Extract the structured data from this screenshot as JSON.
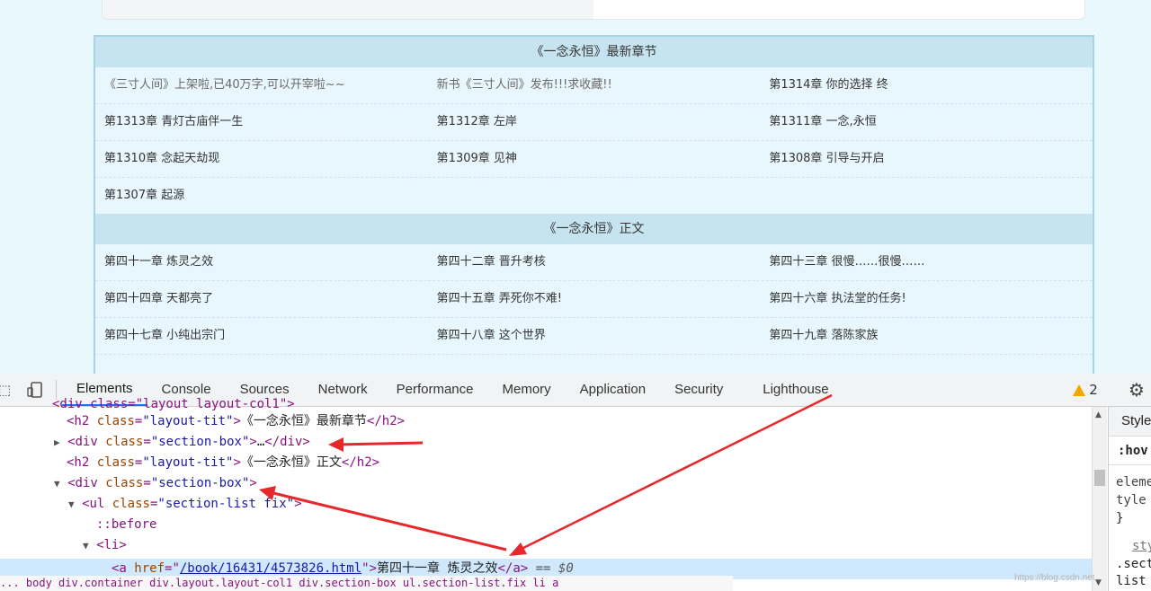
{
  "page": {
    "sections": [
      {
        "title": "《一念永恒》最新章节",
        "rows": [
          [
            "《三寸人间》上架啦,已40万字,可以开宰啦~~",
            "新书《三寸人间》发布!!!求收藏!!",
            "第1314章 你的选择 终"
          ],
          [
            "第1313章 青灯古庙伴一生",
            "第1312章 左岸",
            "第1311章 一念,永恒"
          ],
          [
            "第1310章 念起天劫现",
            "第1309章 见神",
            "第1308章 引导与开启"
          ],
          [
            "第1307章 起源",
            "",
            ""
          ]
        ]
      },
      {
        "title": "《一念永恒》正文",
        "rows": [
          [
            "第四十一章 炼灵之效",
            "第四十二章 晋升考核",
            "第四十三章 很慢……很慢……"
          ],
          [
            "第四十四章 天都亮了",
            "第四十五章 弄死你不难!",
            "第四十六章 执法堂的任务!"
          ],
          [
            "第四十七章 小纯出宗门",
            "第四十八章 这个世界",
            "第四十九章 落陈家族"
          ],
          [
            "",
            "",
            ""
          ]
        ]
      }
    ]
  },
  "devtools": {
    "tabs": [
      "Elements",
      "Console",
      "Sources",
      "Network",
      "Performance",
      "Memory",
      "Application",
      "Security",
      "Lighthouse"
    ],
    "active_tab": "Elements",
    "warning_count": "2",
    "dom": {
      "l0": {
        "tag_open": "<div class=\"layout layout-col1\">"
      },
      "l1": {
        "open": "<h2",
        "attr": "class",
        "val": "\"layout-tit\"",
        "close": ">",
        "text": "《一念永恒》最新章节",
        "end": "</h2>"
      },
      "l2": {
        "open": "<div",
        "attr": "class",
        "val": "\"section-box\"",
        "close": ">",
        "text": "…",
        "end": "</div>"
      },
      "l3": {
        "open": "<h2",
        "attr": "class",
        "val": "\"layout-tit\"",
        "close": ">",
        "text": "《一念永恒》正文",
        "end": "</h2>"
      },
      "l4": {
        "open": "<div",
        "attr": "class",
        "val": "\"section-box\"",
        "close": ">"
      },
      "l5": {
        "open": "<ul",
        "attr": "class",
        "val": "\"section-list fix\"",
        "close": ">"
      },
      "l6": {
        "text": "::before"
      },
      "l7": {
        "open": "<li>"
      },
      "l8": {
        "open": "<a",
        "attr": "href",
        "eq": "=\"",
        "link": "/book/16431/4573826.html",
        "q": "\"",
        "close": ">",
        "text": "第四十一章 炼灵之效",
        "end": "</a>",
        "suffix": " == $0"
      }
    },
    "styles": {
      "header": "Styles",
      "filter": ":hov",
      "lines": [
        "element.s",
        "tyle {",
        "}",
        "sty",
        ".sect",
        "list"
      ]
    },
    "breadcrumb": "... body  div.container  div.layout.layout-col1  div.section-box  ul.section-list.fix  li  a",
    "watermark": "https://blog.csdn.net"
  },
  "colors": {
    "accent": "#1a73e8",
    "arrow": "#e8272a",
    "section_title_bg": "#c6e4f0"
  }
}
